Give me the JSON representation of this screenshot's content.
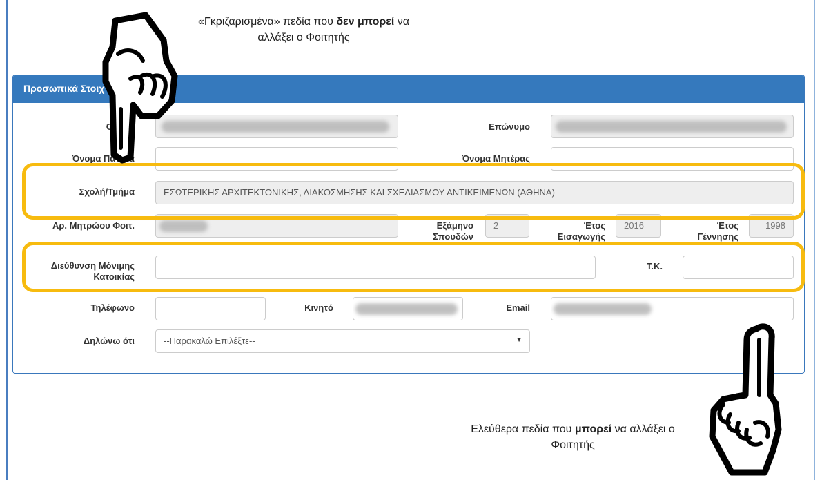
{
  "captions": {
    "top": [
      "«Γκριζαρισμένα» πεδία που ",
      "δεν μπορεί",
      " να",
      "αλλάξει ο Φοιτητής"
    ],
    "bottom": [
      "Ελεύθερα πεδία που ",
      "μπορεί",
      " να αλλάξει ο",
      "Φοιτητής"
    ]
  },
  "panel": {
    "title": "Προσωπικά Στοιχ"
  },
  "labels": {
    "first_name": "Όνομα",
    "surname": "Επώνυμο",
    "father": "Όνομα Πατέρα",
    "mother": "Όνομα Μητέρας",
    "school": "Σχολή/Τμήμα",
    "reg_no": "Αρ. Μητρώου Φοιτ.",
    "semester": [
      "Εξάμηνο",
      "Σπουδών"
    ],
    "entry_year": [
      "Έτος",
      "Εισαγωγής"
    ],
    "birth_year": [
      "Έτος",
      "Γέννησης"
    ],
    "address": [
      "Διεύθυνση Μόνιμης",
      "Κατοικίας"
    ],
    "postal": "Τ.Κ.",
    "phone": "Τηλέφωνο",
    "mobile": "Κινητό",
    "email": "Email",
    "declare": "Δηλώνω ότι"
  },
  "values": {
    "school": "ΕΣΩΤΕΡΙΚΗΣ ΑΡΧΙΤΕΚΤΟΝΙΚΗΣ, ΔΙΑΚΟΣΜΗΣΗΣ ΚΑΙ ΣΧΕΔΙΑΣΜΟΥ ΑΝΤΙΚΕΙΜΕΝΩΝ (ΑΘΗΝΑ)",
    "semester": "2",
    "entry_year": "2016",
    "birth_year": "1998",
    "declare_selected": "--Παρακαλώ Επιλέξτε--"
  },
  "colors": {
    "panel_header": "#3579bd",
    "highlight": "#f7bb0f",
    "disabled_field": "#eeeeee"
  },
  "icons": {
    "top": "pointing-down-hand-icon",
    "bottom": "pointing-up-hand-icon"
  }
}
